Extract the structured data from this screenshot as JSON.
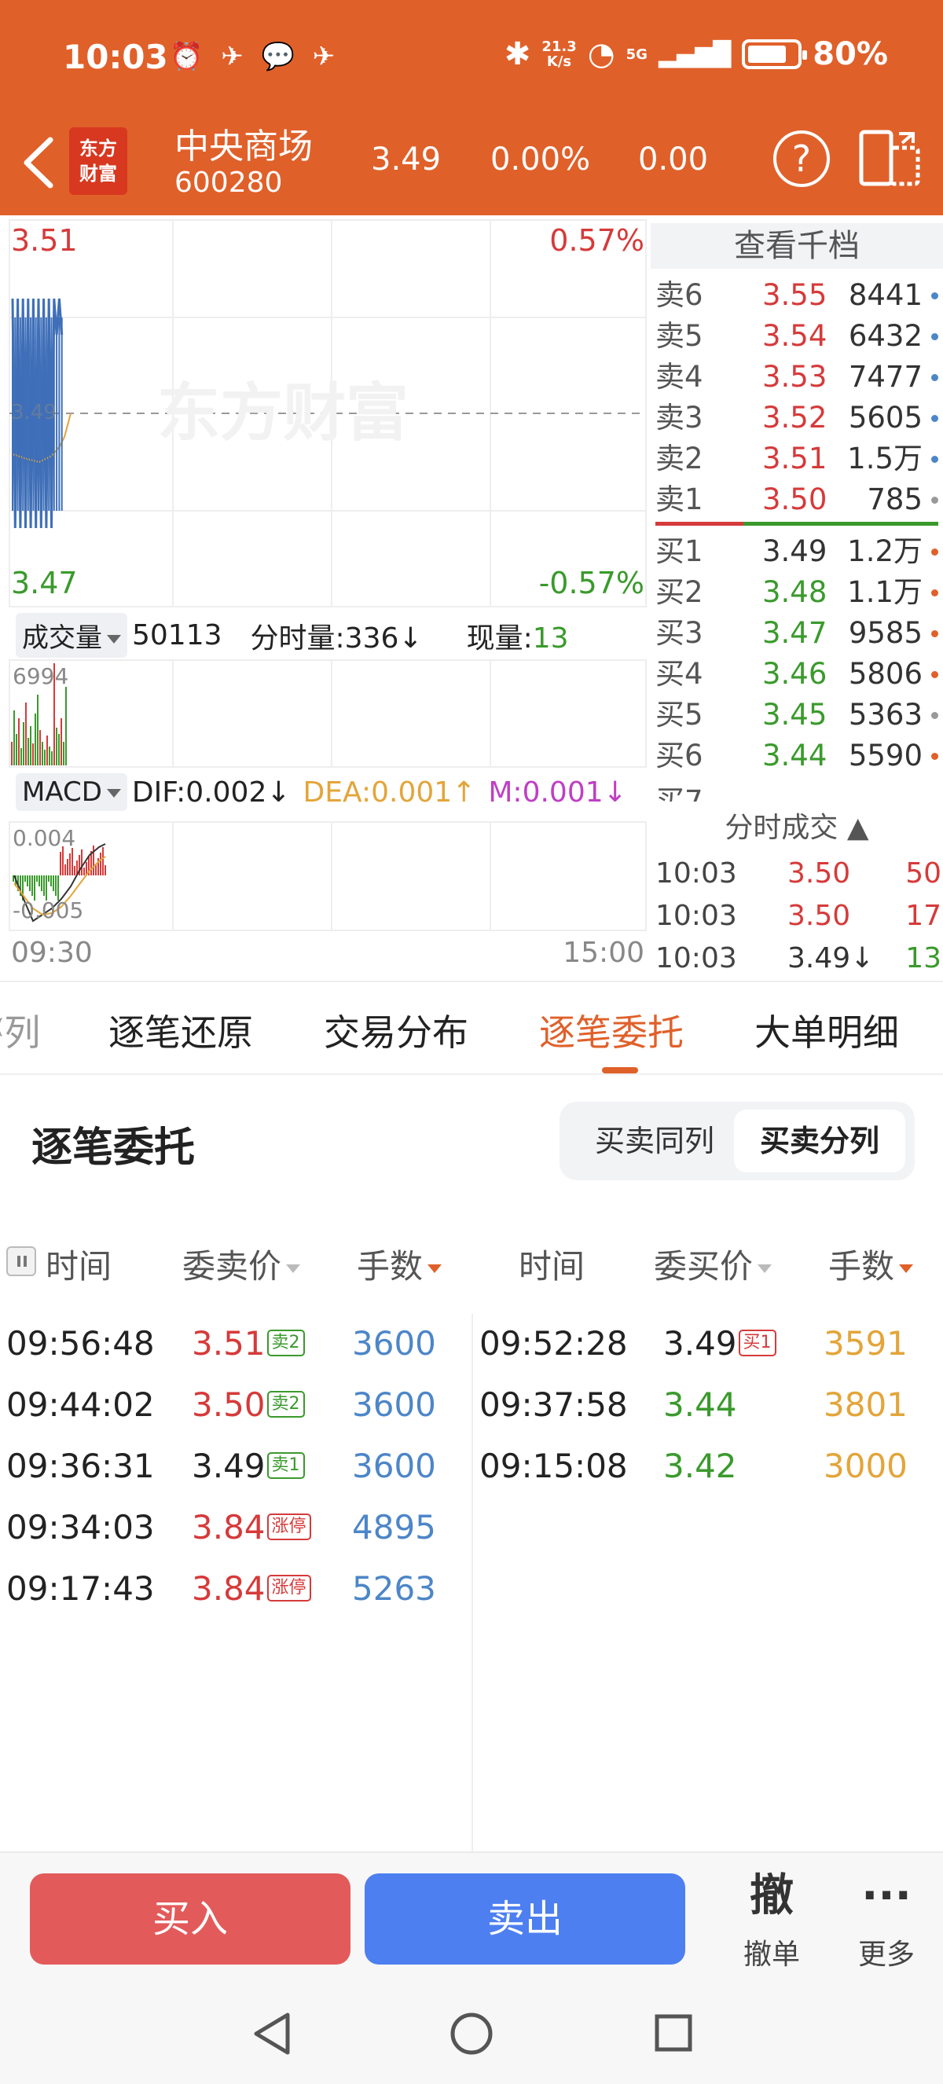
{
  "status_bar": {
    "time": "10:03",
    "net_speed_top": "21.3",
    "net_speed_bottom": "K/s",
    "signal": "5G",
    "battery": "80%",
    "battery_level": 0.8
  },
  "header": {
    "logo_line1": "东方",
    "logo_line2": "财富",
    "stock_name": "中央商场",
    "stock_code": "600280",
    "price": "3.49",
    "change_pct": "0.00%",
    "change": "0.00",
    "help": "?"
  },
  "chart": {
    "high_price": "3.51",
    "high_pct": "0.57%",
    "low_price": "3.47",
    "low_pct": "-0.57%",
    "ref_price": "3.49",
    "watermark": "东方财富",
    "start_time": "09:30",
    "end_time": "15:00",
    "vol_dropdown": "成交量",
    "vol_total": "50113",
    "vol_bar_label": "分时量:",
    "vol_bar_value": "336",
    "vol_now_label": "现量:",
    "vol_now_value": "13",
    "vol_max": "6994",
    "macd_dropdown": "MACD",
    "dif": "DIF:0.002",
    "dea": "DEA:0.001",
    "m": "M:0.001",
    "macd_top": "0.004",
    "macd_bottom": "-0.005"
  },
  "chart_data": {
    "type": "line",
    "title": "",
    "x_range": [
      "09:30",
      "15:00"
    ],
    "ylim": [
      3.47,
      3.51
    ],
    "series": [
      {
        "name": "",
        "values": [
          3.51,
          3.47,
          3.51,
          3.47,
          3.51,
          3.47,
          3.51,
          3.47,
          3.51,
          3.47,
          3.51,
          3.47,
          3.51,
          3.47,
          3.51,
          3.47,
          3.51,
          3.49,
          3.51,
          3.49
        ]
      }
    ]
  },
  "orderbook": {
    "title": "查看千档",
    "asks": [
      {
        "label": "卖6",
        "price": "3.55",
        "vol": "8441",
        "color": "#4d86c8"
      },
      {
        "label": "卖5",
        "price": "3.54",
        "vol": "6432",
        "color": "#4d86c8"
      },
      {
        "label": "卖4",
        "price": "3.53",
        "vol": "7477",
        "color": "#4d86c8"
      },
      {
        "label": "卖3",
        "price": "3.52",
        "vol": "5605",
        "color": "#4d86c8"
      },
      {
        "label": "卖2",
        "price": "3.51",
        "vol": "1.5万",
        "color": "#4d86c8"
      },
      {
        "label": "卖1",
        "price": "3.50",
        "vol": "785",
        "color": "#999999"
      }
    ],
    "bids": [
      {
        "label": "买1",
        "price": "3.49",
        "vol": "1.2万",
        "color": "#e0602a"
      },
      {
        "label": "买2",
        "price": "3.48",
        "vol": "1.1万",
        "color": "#e0602a"
      },
      {
        "label": "买3",
        "price": "3.47",
        "vol": "9585",
        "color": "#e0602a"
      },
      {
        "label": "买4",
        "price": "3.46",
        "vol": "5806",
        "color": "#e0602a"
      },
      {
        "label": "买5",
        "price": "3.45",
        "vol": "5363",
        "color": "#999999"
      },
      {
        "label": "买6",
        "price": "3.44",
        "vol": "5590",
        "color": "#e0602a"
      }
    ]
  },
  "ticks": {
    "title": "分时成交",
    "rows": [
      {
        "time": "10:03",
        "price": "3.50",
        "vol": "50"
      },
      {
        "time": "10:03",
        "price": "3.50",
        "vol": "17"
      },
      {
        "time": "10:03",
        "price": "3.49",
        "vol": "13"
      }
    ]
  },
  "tabs": {
    "partial": "列",
    "t1": "逐笔还原",
    "t2": "交易分布",
    "t3": "逐笔委托",
    "t4": "大单明细"
  },
  "section": {
    "title": "逐笔委托",
    "seg_same": "买卖同列",
    "seg_split": "买卖分列"
  },
  "table": {
    "sell_headers": {
      "time": "时间",
      "price": "委卖价",
      "qty": "手数"
    },
    "buy_headers": {
      "time": "时间",
      "price": "委买价",
      "qty": "手数"
    },
    "sell_rows": [
      {
        "time": "09:56:48",
        "price": "3.51",
        "tag": "卖2",
        "qty": "3600"
      },
      {
        "time": "09:44:02",
        "price": "3.50",
        "tag": "卖2",
        "qty": "3600"
      },
      {
        "time": "09:36:31",
        "price": "3.49",
        "tag": "卖1",
        "qty": "3600"
      },
      {
        "time": "09:34:03",
        "price": "3.84",
        "tag": "涨停",
        "qty": "4895"
      },
      {
        "time": "09:17:43",
        "price": "3.84",
        "tag": "涨停",
        "qty": "5263"
      }
    ],
    "buy_rows": [
      {
        "time": "09:52:28",
        "price": "3.49",
        "tag": "买1",
        "qty": "3591"
      },
      {
        "time": "09:37:58",
        "price": "3.44",
        "tag": "",
        "qty": "3801"
      },
      {
        "time": "09:15:08",
        "price": "3.42",
        "tag": "",
        "qty": "3000"
      }
    ]
  },
  "bottom": {
    "buy": "买入",
    "sell": "卖出",
    "cancel_icon": "撤",
    "cancel": "撤单",
    "more_icon": "···",
    "more": "更多"
  }
}
